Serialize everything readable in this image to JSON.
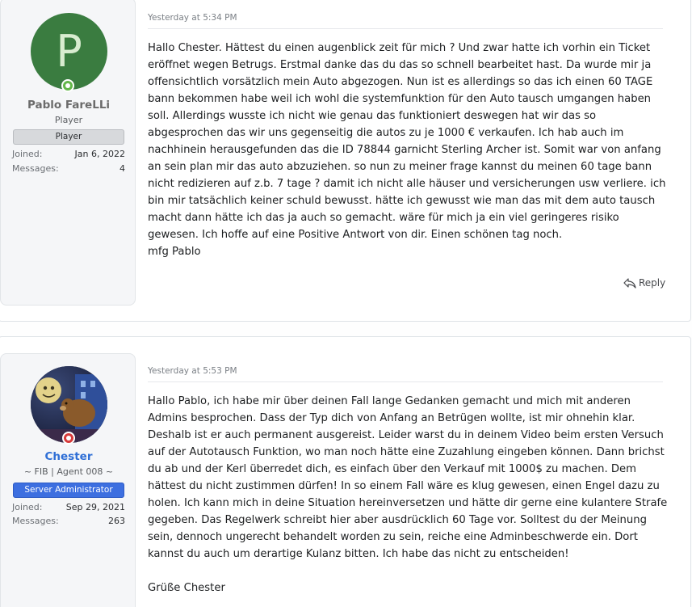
{
  "posts": [
    {
      "date": "Yesterday at 5:34 PM",
      "user": {
        "avatar_letter": "P",
        "name": "Pablo FareLLi",
        "title": "Player",
        "banner": "Player",
        "joined_label": "Joined:",
        "joined": "Jan 6, 2022",
        "messages_label": "Messages:",
        "messages": "4",
        "name_color": "#6b6b6b",
        "status_color": "#63b74a"
      },
      "body": [
        "Hallo Chester. Hättest du einen augenblick zeit für mich ? Und zwar hatte ich vorhin ein Ticket eröffnet wegen Betrugs. Erstmal danke das du das so schnell bearbeitet hast. Da wurde mir ja offensichtlich vorsätzlich mein Auto abgezogen. Nun ist es allerdings so das ich einen 60 TAGE bann bekommen habe weil ich wohl die systemfunktion für den Auto tausch umgangen haben soll. Allerdings wusste ich nicht wie genau das funktioniert deswegen hat wir das so abgesprochen das wir uns gegenseitig die autos zu je 1000 € verkaufen. Ich hab auch im nachhinein herausgefunden das die ID 78844 garnicht Sterling Archer ist. Somit war von anfang an sein plan mir das auto abzuziehen. so nun zu meiner frage kannst du meinen 60 tage bann nicht redizieren auf z.b. 7 tage ? damit ich nicht alle häuser und versicherungen usw verliere. ich bin mir tatsächlich keiner schuld bewusst. hätte ich gewusst wie man das mit dem auto tausch macht dann hätte ich das ja auch so gemacht. wäre für mich ja ein viel geringeres risiko gewesen. Ich hoffe auf eine Positive Antwort von dir. Einen schönen tag noch.",
        "mfg Pablo"
      ],
      "reply_label": "Reply"
    },
    {
      "date": "Yesterday at 5:53 PM",
      "user": {
        "name": "Chester",
        "title": "~ FIB | Agent 008 ~",
        "banner": "Server Administrator",
        "joined_label": "Joined:",
        "joined": "Sep 29, 2021",
        "messages_label": "Messages:",
        "messages": "263",
        "name_color": "#2f6fd6",
        "status_color": "#d63a3a"
      },
      "body": [
        "Hallo Pablo, ich habe mir über deinen Fall lange Gedanken gemacht und mich mit anderen Admins besprochen. Dass der Typ dich von Anfang an Betrügen wollte, ist mir ohnehin klar. Deshalb ist er auch permanent ausgereist. Leider warst du in deinem Video beim ersten Versuch auf der Autotausch Funktion, wo man noch hätte eine Zuzahlung eingeben können. Dann brichst du ab und der Kerl überredet dich, es einfach über den Verkauf mit 1000$ zu machen. Dem hättest du nicht zustimmen dürfen! In so einem Fall wäre es klug gewesen, einen Engel dazu zu holen. Ich kann mich in deine Situation hereinversetzen und hätte dir gerne eine kulantere Strafe gegeben. Das Regelwerk schreibt hier aber ausdrücklich 60 Tage vor. Solltest du der Meinung sein, dennoch ungerecht behandelt worden zu sein, reiche eine Adminbeschwerde ein. Dort kannst du auch um derartige Kulanz bitten. Ich habe das nicht zu entscheiden!",
        "Grüße Chester"
      ]
    }
  ]
}
